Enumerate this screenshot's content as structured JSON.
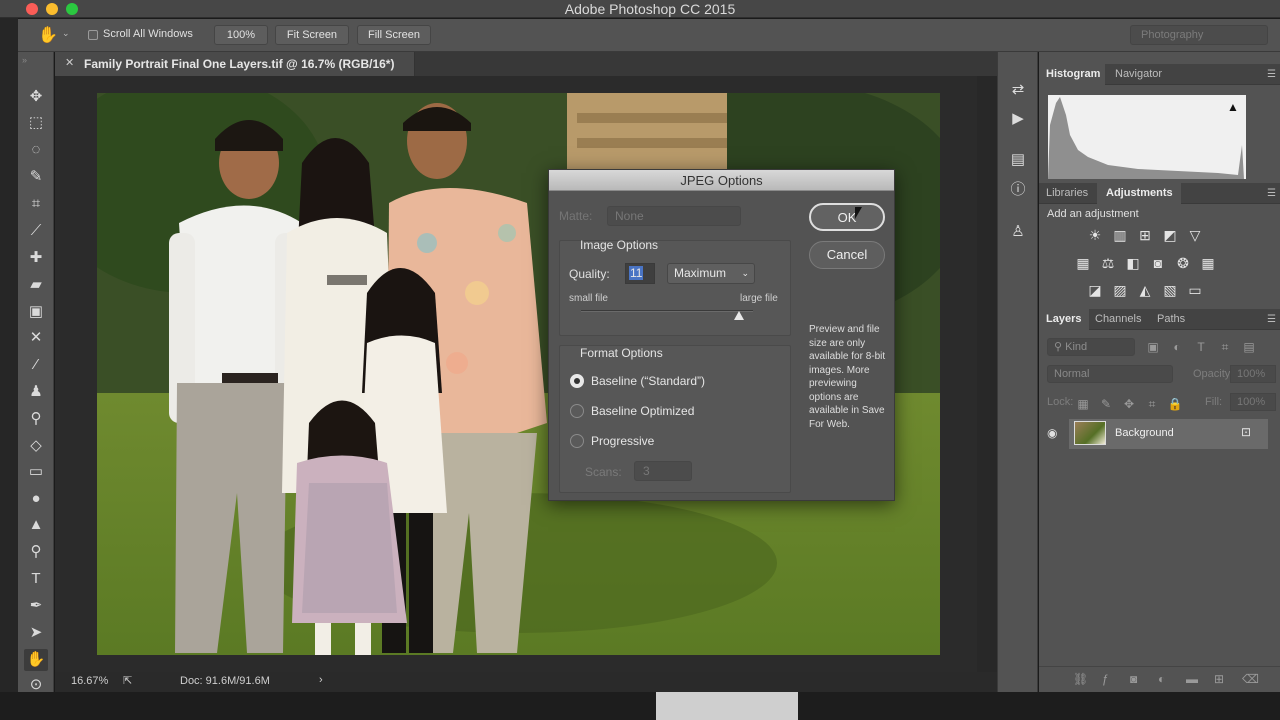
{
  "app": {
    "title": "Adobe Photoshop CC 2015"
  },
  "options_bar": {
    "scroll_all_windows": "Scroll All Windows",
    "zoom_100": "100%",
    "fit_screen": "Fit Screen",
    "fill_screen": "Fill Screen",
    "workspace": "Photography"
  },
  "document": {
    "tab_title": "Family Portrait Final One Layers.tif @ 16.7% (RGB/16*)",
    "zoom_level": "16.67%",
    "doc_size": "Doc: 91.6M/91.6M"
  },
  "jpeg_dialog": {
    "title": "JPEG Options",
    "matte_label": "Matte:",
    "matte_value": "None",
    "image_options_title": "Image Options",
    "quality_label": "Quality:",
    "quality_value": "11",
    "quality_preset": "Maximum",
    "small_file": "small file",
    "large_file": "large file",
    "quality_slider_fraction": 0.92,
    "format_options_title": "Format Options",
    "format_options": [
      {
        "label": "Baseline (“Standard”)",
        "selected": true
      },
      {
        "label": "Baseline Optimized",
        "selected": false
      },
      {
        "label": "Progressive",
        "selected": false
      }
    ],
    "scans_label": "Scans:",
    "scans_value": "3",
    "ok": "OK",
    "cancel": "Cancel",
    "preview_note": "Preview and file size are only available for 8-bit images. More previewing options are available in Save For Web."
  },
  "panels": {
    "histogram_tabs": [
      "Histogram",
      "Navigator"
    ],
    "adjustment_tabs": [
      "Libraries",
      "Adjustments"
    ],
    "add_adjustment": "Add an adjustment",
    "layers_tabs": [
      "Layers",
      "Channels",
      "Paths"
    ],
    "kind_placeholder": "Kind",
    "blend_mode": "Normal",
    "opacity_label": "Opacity:",
    "opacity_value": "100%",
    "lock_label": "Lock:",
    "fill_label": "Fill:",
    "fill_value": "100%",
    "layer_name": "Background"
  },
  "colors": {
    "panel": "#535353",
    "dialog_title": "#c8c8c8",
    "selection": "#4a74c4"
  }
}
